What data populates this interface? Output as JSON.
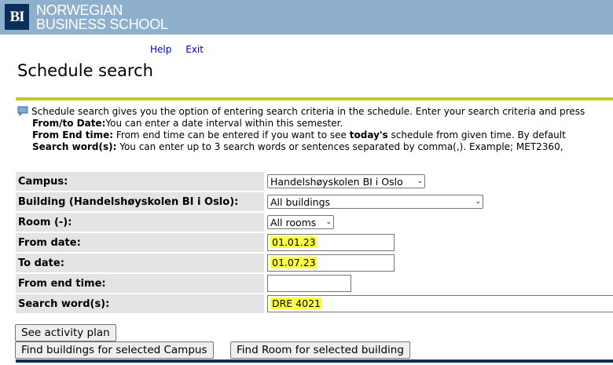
{
  "header": {
    "logo_mark": "BI",
    "logo_line1": "NORWEGIAN",
    "logo_line2": "BUSINESS SCHOOL"
  },
  "toplinks": {
    "help": "Help",
    "exit": "Exit"
  },
  "page_title": "Schedule search",
  "info": {
    "intro": "Schedule search gives you the option of entering search criteria in the schedule. Enter your search criteria and press",
    "from_to_label": "From/to Date:",
    "from_to_text": "You can enter a date interval within this semester.",
    "end_time_label": "From End time:",
    "end_time_text1": " From end time can be entered if you want to see ",
    "end_time_bold": "today's",
    "end_time_text2": " schedule from given time. By default",
    "search_label": "Search word(s):",
    "search_text": " You can enter up to 3 search words or sentences separated by comma(,). Example; MET2360,"
  },
  "form": {
    "campus_label": "Campus:",
    "campus_value": "Handelshøyskolen BI i Oslo",
    "building_label": "Building (Handelshøyskolen BI i Oslo):",
    "building_value": "All buildings",
    "room_label": "Room (-):",
    "room_value": "All rooms",
    "from_date_label": "From date:",
    "from_date_value": "01.01.23",
    "to_date_label": "To date:",
    "to_date_value": "01.07.23",
    "end_time_label": "From end time:",
    "end_time_value": "",
    "search_label": "Search word(s):",
    "search_value": "DRE 4021"
  },
  "buttons": {
    "activity_plan": "See activity plan",
    "find_buildings": "Find buildings for selected Campus",
    "find_room": "Find Room for selected building"
  },
  "colors": {
    "header_bg": "#8fb0cd",
    "logo_bg": "#0b2f5b",
    "rule": "#c8c81e",
    "highlight": "#ffff40",
    "link": "#0000cc"
  }
}
